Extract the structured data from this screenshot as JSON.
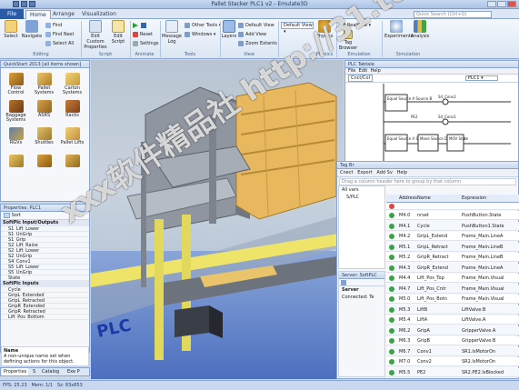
{
  "window": {
    "title": "Pallet Stacker PLC1 v2 - Emulate3D"
  },
  "ribbon": {
    "file_tab": "File",
    "tabs": [
      "Home",
      "Arrange",
      "Visualization"
    ],
    "search_placeholder": "Quick Search (Ctrl+Q)",
    "select": "Select",
    "navigate": "Navigate",
    "find": "Find",
    "find_next": "Find Next",
    "select_all": "Select All",
    "editing": "Editing",
    "edit_custom_properties": "Edit Custom Properties",
    "edit_script": "Edit Script",
    "script": "Script",
    "reset": "Reset",
    "settings": "Settings",
    "animate": "Animate",
    "message_log": "Message Log",
    "other_tools": "Other Tools",
    "windows": "Windows",
    "tools": "Tools",
    "layers": "Layers",
    "default_view": "Default View",
    "add_view": "Add View",
    "zoom_extents": "Zoom Extents",
    "view": "View",
    "default_view_select": "Default View",
    "physics": "Physics",
    "realtime": "Realtime",
    "tag_browser": "Tag Browser",
    "emulation": "Emulation",
    "experiments": "Experiments",
    "analysis": "Analysis",
    "simulation": "Simulation"
  },
  "library": {
    "title": "QuickStart 2013 [all items shown]",
    "items": [
      "Flow Control",
      "Pallet Systems",
      "Carton Systems",
      "Baggage Systems",
      "ASRS",
      "Racks",
      "RGVs",
      "Shuttles",
      "Pallet Lifts"
    ]
  },
  "properties": {
    "title": "Properties: PLC1",
    "sort_label": "Sort",
    "cat_io": "SoftPlc Input/Outputs",
    "io": [
      "S1_Lift_Lower",
      "S1_UnGrip",
      "S1_Grip",
      "S2_Lift_Raise",
      "S2_Lift_Lower",
      "S2_UnGrip",
      "S4_Conv1",
      "S5_Lift_Lower",
      "S5_UnGrip",
      "State"
    ],
    "cat_inputs": "SoftPlc Inputs",
    "inputs": [
      "Cycle",
      "GripL_Extended",
      "GripL_Retracted",
      "GripR_Extended",
      "GripR_Retracted",
      "Lift_Pos_Bottom"
    ],
    "desc_title": "Name",
    "desc_text": "A non-unique name set when defining actions for this object.",
    "tabs": [
      "Properties",
      "S",
      "Catalog",
      "Exe P"
    ]
  },
  "status_bar": {
    "fps": "FPS: 25.23",
    "mem": "Mem: 1/1",
    "size": "Sz: 83x653"
  },
  "plc": {
    "title": "PLC Tabtale",
    "menu": [
      "File",
      "Edit",
      "Help"
    ],
    "tab": "Cnct/Col",
    "select": "PLC1",
    "blocks": [
      "Equal Source A Source B",
      "S4_Conv2",
      "S4_Conv1",
      "PE2",
      "Equal Source A Source B",
      "Move Source Destination",
      "MOV State"
    ]
  },
  "tags": {
    "title": "Tag Br",
    "toolbar": [
      "Cnect",
      "Export",
      "Add Sv",
      "Help"
    ],
    "filter_hint": "Drag a column header here to group by that column",
    "tree": [
      "All vars",
      "S/PLC"
    ],
    "server_title": "Server: SoftPLC",
    "server_label": "Server",
    "server_connected": "Connected: Te",
    "columns": [
      "Address",
      "Name",
      "Expression"
    ],
    "rows": [
      {
        "addr": "M4.0",
        "name": "nrset",
        "expr": "PushButton.State",
        "checked": false
      },
      {
        "addr": "M4.1",
        "name": "Cycle",
        "expr": "PushButton1.State",
        "checked": false
      },
      {
        "addr": "M4.2",
        "name": "GripL_Extend",
        "expr": "Frame_Main.LineA",
        "checked": true
      },
      {
        "addr": "M5.1",
        "name": "GripL_Retract",
        "expr": "Frame_Main.LineB",
        "checked": true
      },
      {
        "addr": "M5.2",
        "name": "GripR_Retract",
        "expr": "Frame_Main.LineB",
        "checked": true
      },
      {
        "addr": "M4.3",
        "name": "GripR_Extend",
        "expr": "Frame_Main.LineA",
        "checked": true
      },
      {
        "addr": "M4.4",
        "name": "Lift_Pos_Top",
        "expr": "Frame_Main.Visual",
        "checked": true
      },
      {
        "addr": "M4.7",
        "name": "Lift_Pos_Cntr",
        "expr": "Frame_Main.Visual",
        "checked": false
      },
      {
        "addr": "M5.0",
        "name": "Lift_Pos_Botn",
        "expr": "Frame_Main.Visual",
        "checked": false
      },
      {
        "addr": "M5.3",
        "name": "LiftB",
        "expr": "LiftValve.B",
        "checked": false
      },
      {
        "addr": "M5.4",
        "name": "LiftA",
        "expr": "LiftValve.A",
        "checked": false
      },
      {
        "addr": "M6.2",
        "name": "GripA",
        "expr": "GripperValve.A",
        "checked": false
      },
      {
        "addr": "M6.3",
        "name": "GripB",
        "expr": "GripperValve.B",
        "checked": false
      },
      {
        "addr": "M6.7",
        "name": "Conv1",
        "expr": "SR1.IsMotorOn",
        "checked": true
      },
      {
        "addr": "M7.0",
        "name": "Conv2",
        "expr": "SR2.IsMotorOn",
        "checked": true
      },
      {
        "addr": "M5.5",
        "name": "PE2",
        "expr": "SR2.PE2.IsBlocked",
        "checked": false
      }
    ]
  },
  "scene": {
    "floor_text": "PLC"
  },
  "watermark": {
    "text": "xxx软件精品社 http://31.to"
  }
}
